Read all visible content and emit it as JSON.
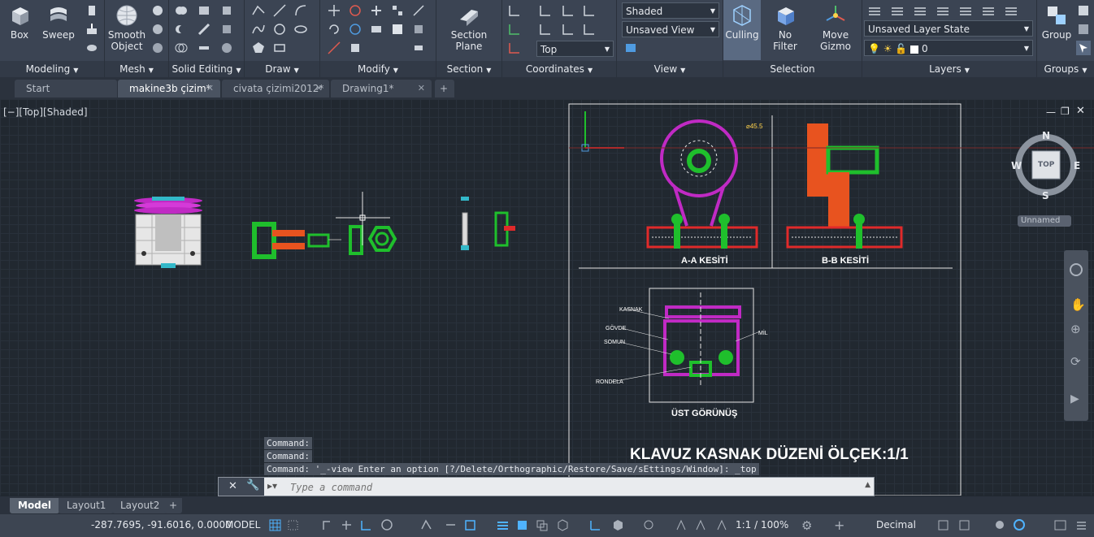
{
  "ribbon": {
    "modeling": {
      "title": "Modeling",
      "box": "Box",
      "sweep": "Sweep"
    },
    "mesh": {
      "title": "Mesh",
      "smooth_object": "Smooth Object"
    },
    "solid_editing": {
      "title": "Solid Editing"
    },
    "draw": {
      "title": "Draw"
    },
    "modify": {
      "title": "Modify"
    },
    "section": {
      "title": "Section",
      "section_plane": "Section Plane"
    },
    "coordinates": {
      "title": "Coordinates"
    },
    "view": {
      "title": "View",
      "visual_style": "Shaded",
      "saved_view": "Unsaved View",
      "named_view": "Top"
    },
    "selection": {
      "title": "Selection",
      "culling": "Culling",
      "no_filter": "No Filter",
      "move_gizmo": "Move Gizmo"
    },
    "layers": {
      "title": "Layers",
      "layer_state": "Unsaved Layer State",
      "current_layer": "0"
    },
    "groups": {
      "title": "Groups",
      "group": "Group"
    }
  },
  "file_tabs": [
    {
      "label": "Start"
    },
    {
      "label": "makine3b çizim*"
    },
    {
      "label": "civata çizimi2012*"
    },
    {
      "label": "Drawing1*"
    }
  ],
  "viewport": {
    "label": "[−][Top][Shaded]",
    "viewcube": {
      "n": "N",
      "s": "S",
      "e": "E",
      "w": "W",
      "face": "TOP",
      "ucs": "Unnamed"
    }
  },
  "drawing": {
    "main_title": "KLAVUZ KASNAK DÜZENİ ÖLÇEK:1/1",
    "section_aa": "A-A KESİTİ",
    "section_bb": "B-B KESİTİ",
    "top_view": "ÜST GÖRÜNÜŞ",
    "labels": {
      "kasnak": "KASNAK",
      "govde": "GÖVDE",
      "somun": "SOMUN",
      "rondela": "RONDELA",
      "mil": "MİL",
      "dimension": "⌀45.5"
    }
  },
  "command_line": {
    "history": [
      "Command:",
      "Command:",
      "Command: '_-view Enter an option [?/Delete/Orthographic/Restore/Save/sEttings/Window]: _top"
    ],
    "placeholder": "Type a command"
  },
  "layout_tabs": [
    {
      "label": "Model"
    },
    {
      "label": "Layout1"
    },
    {
      "label": "Layout2"
    }
  ],
  "status_bar": {
    "coordinates": "-287.7695, -91.6016, 0.0000",
    "space": "MODEL",
    "annotation_scale": "1:1 / 100%",
    "units": "Decimal"
  }
}
